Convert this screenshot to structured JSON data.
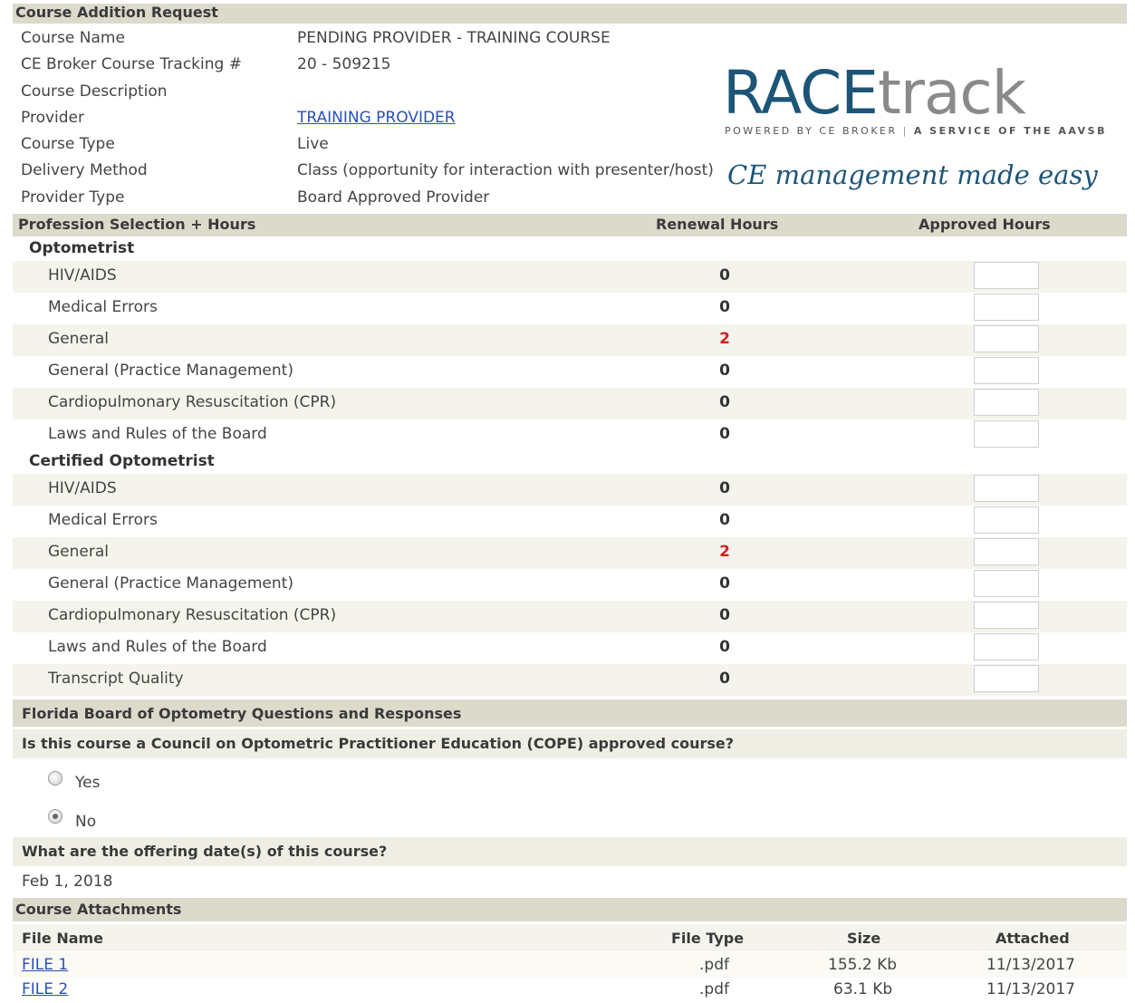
{
  "course_request": {
    "title": "Course Addition Request",
    "fields": [
      {
        "label": "Course Name",
        "value": "PENDING PROVIDER - TRAINING COURSE"
      },
      {
        "label": "CE Broker Course Tracking #",
        "value": "20 - 509215"
      },
      {
        "label": "Course Description",
        "value": ""
      },
      {
        "label": "Provider",
        "value": "TRAINING PROVIDER"
      },
      {
        "label": "Course Type",
        "value": "Live"
      },
      {
        "label": "Delivery Method",
        "value": "Class (opportunity for interaction with presenter/host)"
      },
      {
        "label": "Provider Type",
        "value": "Board Approved Provider"
      }
    ]
  },
  "logo": {
    "race": "RACE",
    "track": "track",
    "powered_by": "POWERED BY CE BROKER",
    "service": "A SERVICE OF THE AAVSB",
    "tagline": "CE management made easy"
  },
  "profession": {
    "title": "Profession Selection + Hours",
    "col_renewal": "Renewal Hours",
    "col_approved": "Approved Hours",
    "groups": [
      {
        "name": "Optometrist",
        "rows": [
          {
            "subject": "HIV/AIDS",
            "hours": "0"
          },
          {
            "subject": "Medical Errors",
            "hours": "0"
          },
          {
            "subject": "General",
            "hours": "2"
          },
          {
            "subject": "General (Practice Management)",
            "hours": "0"
          },
          {
            "subject": "Cardiopulmonary Resuscitation (CPR)",
            "hours": "0"
          },
          {
            "subject": "Laws and Rules of the Board",
            "hours": "0"
          }
        ]
      },
      {
        "name": "Certified Optometrist",
        "rows": [
          {
            "subject": "HIV/AIDS",
            "hours": "0"
          },
          {
            "subject": "Medical Errors",
            "hours": "0"
          },
          {
            "subject": "General",
            "hours": "2"
          },
          {
            "subject": "General (Practice Management)",
            "hours": "0"
          },
          {
            "subject": "Cardiopulmonary Resuscitation (CPR)",
            "hours": "0"
          },
          {
            "subject": "Laws and Rules of the Board",
            "hours": "0"
          },
          {
            "subject": "Transcript Quality",
            "hours": "0"
          }
        ]
      }
    ],
    "highlight_color": "#d42020"
  },
  "questions": {
    "title": "Florida Board of Optometry Questions and Responses",
    "q1": "Is this course a Council on Optometric Practitioner Education (COPE) approved course?",
    "opt_yes": "Yes",
    "opt_no": "No",
    "selected": "No",
    "q2": "What are the offering date(s) of this course?",
    "q2_answer": "Feb 1, 2018"
  },
  "attachments": {
    "title": "Course Attachments",
    "col_name": "File Name",
    "col_type": "File Type",
    "col_size": "Size",
    "col_attached": "Attached",
    "files": [
      {
        "name": "FILE 1",
        "type": ".pdf",
        "size": "155.2 Kb",
        "attached": "11/13/2017"
      },
      {
        "name": "FILE 2",
        "type": ".pdf",
        "size": "63.1 Kb",
        "attached": "11/13/2017"
      }
    ]
  }
}
